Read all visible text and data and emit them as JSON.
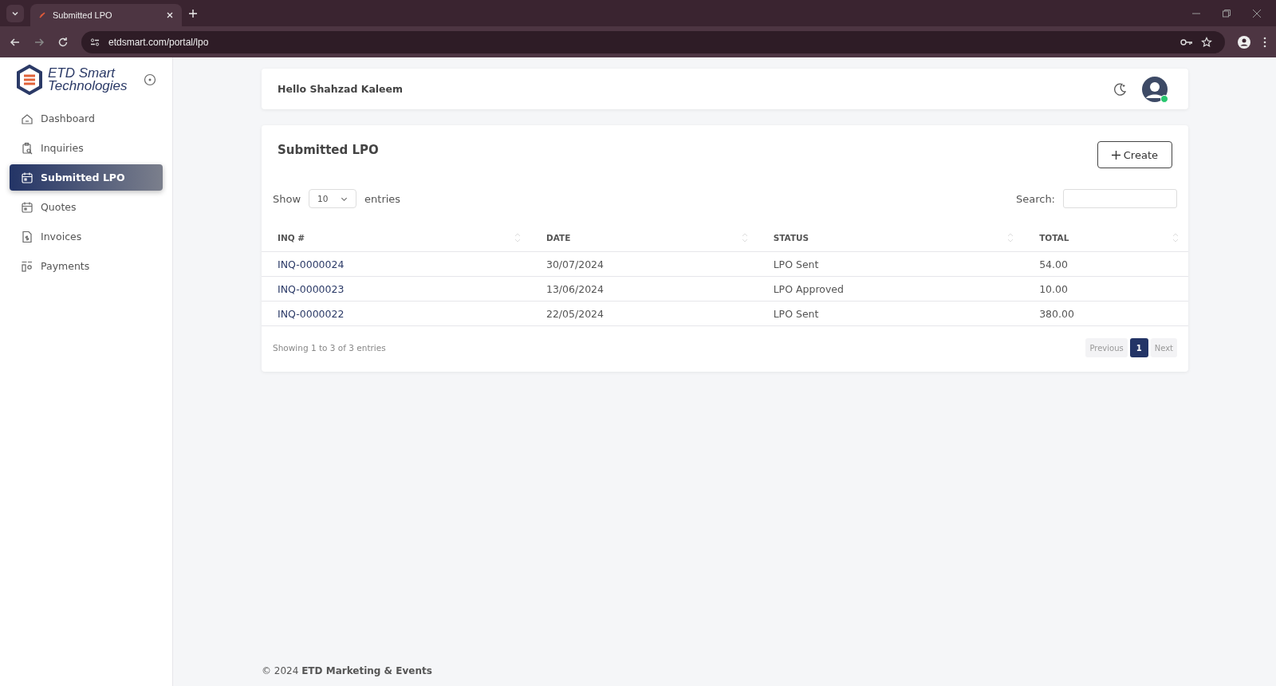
{
  "browser": {
    "tab_title": "Submitted LPO",
    "url": "etdsmart.com/portal/lpo"
  },
  "sidebar": {
    "logo_text": [
      "ETD Smart",
      "Technologies"
    ],
    "items": [
      {
        "label": "Dashboard",
        "kind": "home",
        "selected": false
      },
      {
        "label": "Inquiries",
        "kind": "clipboard",
        "selected": false
      },
      {
        "label": "Submitted LPO",
        "kind": "calendar",
        "selected": true
      },
      {
        "label": "Quotes",
        "kind": "calendar",
        "selected": false
      },
      {
        "label": "Invoices",
        "kind": "invoice",
        "selected": false
      },
      {
        "label": "Payments",
        "kind": "payments",
        "selected": false
      }
    ]
  },
  "header": {
    "greeting": "Hello Shahzad Kaleem",
    "online": true
  },
  "panel": {
    "title": "Submitted LPO",
    "create_button": "Create",
    "show_label": "Show",
    "page_size": "10",
    "entries_label": "entries",
    "search_label": "Search:",
    "columns": [
      "INQ #",
      "DATE",
      "STATUS",
      "TOTAL"
    ],
    "rows": [
      [
        "INQ-0000024",
        "30/07/2024",
        "LPO Sent",
        "54.00"
      ],
      [
        "INQ-0000023",
        "13/06/2024",
        "LPO Approved",
        "10.00"
      ],
      [
        "INQ-0000022",
        "22/05/2024",
        "LPO Sent",
        "380.00"
      ]
    ],
    "info": "Showing 1 to 3 of 3 entries",
    "pagination": [
      {
        "label": "Previous",
        "kind": "prev",
        "selected": false
      },
      {
        "label": "1",
        "kind": "page",
        "selected": true
      },
      {
        "label": "Next",
        "kind": "next",
        "selected": false
      }
    ]
  },
  "footer": "© 2024 **ETD Marketing & Events**"
}
